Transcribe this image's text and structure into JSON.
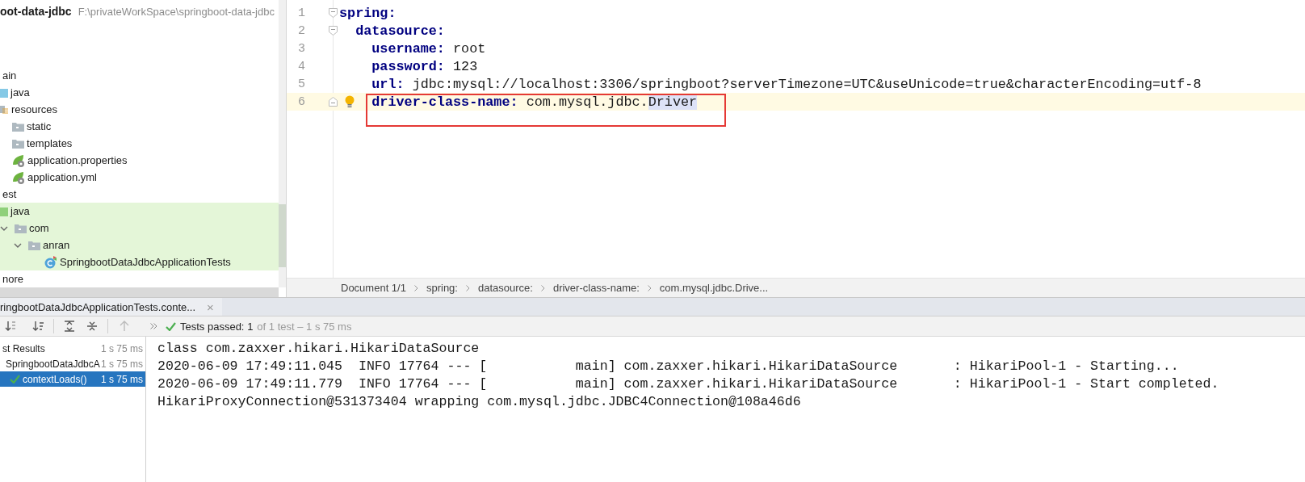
{
  "project": {
    "name": "oot-data-jdbc",
    "path": "F:\\privateWorkSpace\\springboot-data-jdbc"
  },
  "tree": [
    {
      "label": "ain",
      "test_scope": false,
      "children": [
        {
          "label": "java",
          "kind": "source-root",
          "test_scope": false
        },
        {
          "label": "resources",
          "kind": "resources-root",
          "test_scope": false,
          "children": [
            {
              "label": "static",
              "kind": "folder",
              "test_scope": false
            },
            {
              "label": "templates",
              "kind": "folder",
              "test_scope": false
            },
            {
              "label": "application.properties",
              "kind": "spring-config",
              "test_scope": false
            },
            {
              "label": "application.yml",
              "kind": "spring-config",
              "test_scope": false
            }
          ]
        }
      ]
    },
    {
      "label": "est",
      "test_scope": false,
      "children": [
        {
          "label": "java",
          "kind": "test-root",
          "test_scope": true,
          "children": [
            {
              "label": "com",
              "kind": "folder",
              "expanded": true,
              "test_scope": true,
              "children": [
                {
                  "label": "anran",
                  "kind": "folder",
                  "expanded": true,
                  "test_scope": true,
                  "children": [
                    {
                      "label": "SpringbootDataJdbcApplicationTests",
                      "kind": "test-class",
                      "test_scope": true
                    }
                  ]
                }
              ]
            }
          ]
        }
      ]
    },
    {
      "label": "nore",
      "test_scope": false
    }
  ],
  "editor": {
    "lines": [
      {
        "number": "1",
        "key": "spring:",
        "fold_open": true,
        "fold_close": false,
        "current": false,
        "bulb": false,
        "boxed": false
      },
      {
        "number": "2",
        "key": "  datasource:",
        "fold_open": true,
        "fold_close": false,
        "current": false,
        "bulb": false,
        "boxed": false
      },
      {
        "number": "3",
        "key": "    username:",
        "value": " root",
        "fold_open": false,
        "fold_close": false,
        "current": false,
        "bulb": false,
        "boxed": false
      },
      {
        "number": "4",
        "key": "    password:",
        "value": " 123",
        "fold_open": false,
        "fold_close": false,
        "current": false,
        "bulb": false,
        "boxed": false
      },
      {
        "number": "5",
        "key": "    url:",
        "value": " jdbc:mysql://localhost:3306/springboot?serverTimezone=UTC&useUnicode=true&characterEncoding=utf-8",
        "fold_open": false,
        "fold_close": false,
        "current": false,
        "bulb": false,
        "boxed": false
      },
      {
        "number": "6",
        "key": "    driver-class-name:",
        "value": " com.mysql.jdbc.",
        "selected_text": "Driver",
        "fold_open": false,
        "fold_close": true,
        "current": true,
        "bulb": true,
        "boxed": true
      }
    ],
    "breadcrumbs": [
      "Document 1/1",
      "spring:",
      "datasource:",
      "driver-class-name:",
      "com.mysql.jdbc.Drive..."
    ]
  },
  "run_panel": {
    "tab": {
      "label": "ringbootDataJdbcApplicationTests.conte...",
      "close": "×"
    },
    "status": {
      "label": "Tests passed:",
      "count": "1",
      "detail": "of 1 test – 1 s 75 ms"
    },
    "results": [
      {
        "label": "st Results",
        "time": "1 s 75 ms",
        "selected": false,
        "passed": false,
        "children": [
          {
            "label": "SpringbootDataJdbcA",
            "time": "1 s 75 ms",
            "selected": false,
            "passed": false,
            "children": [
              {
                "label": "contextLoads()",
                "time": "1 s 75 ms",
                "selected": true,
                "passed": true
              }
            ]
          }
        ]
      }
    ],
    "console": [
      "class com.zaxxer.hikari.HikariDataSource",
      "2020-06-09 17:49:11.045  INFO 17764 --- [           main] com.zaxxer.hikari.HikariDataSource       : HikariPool-1 - Starting...",
      "2020-06-09 17:49:11.779  INFO 17764 --- [           main] com.zaxxer.hikari.HikariDataSource       : HikariPool-1 - Start completed.",
      "HikariProxyConnection@531373404 wrapping com.mysql.jdbc.JDBC4Connection@108a46d6"
    ]
  }
}
